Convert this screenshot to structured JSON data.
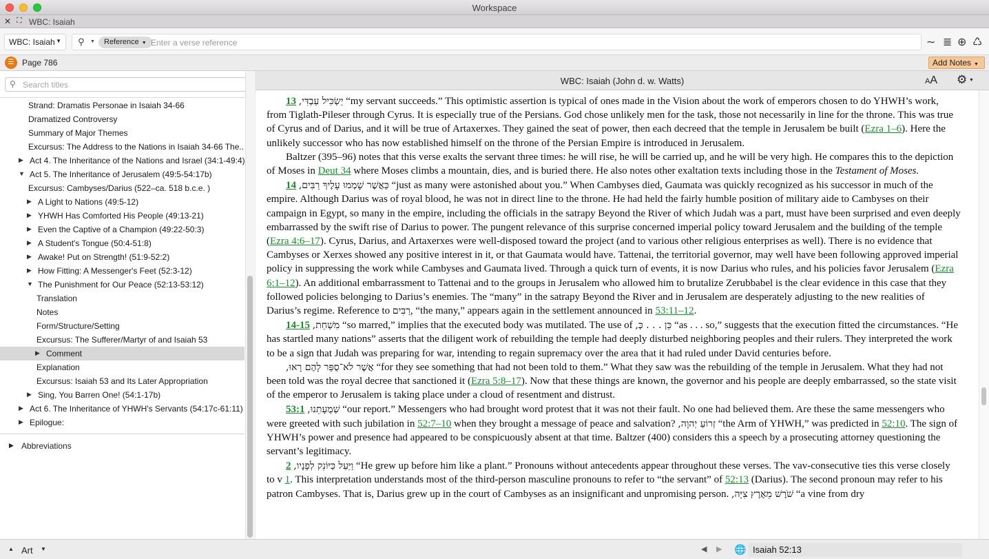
{
  "window": {
    "title": "Workspace"
  },
  "tab": {
    "label": "WBC: Isaiah",
    "close_glyph": "✕",
    "expand_glyph": "⛶"
  },
  "toolbar": {
    "resource": "WBC: Isaiah",
    "reference_pill": "Reference",
    "reference_placeholder": "Enter a verse reference",
    "icons": [
      "wave-icon",
      "list-icon",
      "add-circle-icon",
      "recycle-icon"
    ]
  },
  "subbar": {
    "page": "Page 786",
    "add_notes": "Add Notes"
  },
  "sidebar": {
    "search_placeholder": "Search titles",
    "toc": [
      {
        "label": "Strand: Dramatis Personae in Isaiah 34-66",
        "indent": 41,
        "arrow": ""
      },
      {
        "label": "Dramatized Controversy",
        "indent": 41,
        "arrow": ""
      },
      {
        "label": "Summary of Major Themes",
        "indent": 41,
        "arrow": ""
      },
      {
        "label": "Excursus: The Address to the Nations in Isaiah 34-66 The...",
        "indent": 41,
        "arrow": ""
      },
      {
        "label": "Act 4. The Inheritance of the Nations and Israel (34:1-49:4)",
        "indent": 43,
        "arrow": "right"
      },
      {
        "label": "Act 5. The Inheritance of Jerusalem (49:5-54:17b)",
        "indent": 43,
        "arrow": "down"
      },
      {
        "label": "Excursus: Cambyses/Darius (522–ca. 518 b.c.e. )",
        "indent": 41,
        "arrow": ""
      },
      {
        "label": "A Light to Nations (49:5-12)",
        "indent": 55,
        "arrow": "right"
      },
      {
        "label": "YHWH Has Comforted His People (49:13-21)",
        "indent": 55,
        "arrow": "right"
      },
      {
        "label": "Even the Captive of a Champion (49:22-50:3)",
        "indent": 55,
        "arrow": "right"
      },
      {
        "label": "A Student's Tongue (50:4-51:8)",
        "indent": 55,
        "arrow": "right"
      },
      {
        "label": "Awake! Put on Strength!  (51:9-52:2)",
        "indent": 55,
        "arrow": "right"
      },
      {
        "label": "How Fitting: A Messenger's Feet (52:3-12)",
        "indent": 55,
        "arrow": "right"
      },
      {
        "label": "The Punishment for Our Peace (52:13-53:12)",
        "indent": 55,
        "arrow": "down"
      },
      {
        "label": "Translation",
        "indent": 53,
        "arrow": ""
      },
      {
        "label": "Notes",
        "indent": 53,
        "arrow": ""
      },
      {
        "label": "Form/Structure/Setting",
        "indent": 53,
        "arrow": ""
      },
      {
        "label": "Excursus: The Sufferer/Martyr of and Isaiah 53",
        "indent": 53,
        "arrow": ""
      },
      {
        "label": "Comment",
        "indent": 67,
        "arrow": "right",
        "selected": true
      },
      {
        "label": "Explanation",
        "indent": 53,
        "arrow": ""
      },
      {
        "label": "Excursus: Isaiah 53 and Its Later Appropriation",
        "indent": 53,
        "arrow": ""
      },
      {
        "label": "Sing, You Barren One!  (54:1-17b)",
        "indent": 55,
        "arrow": "right"
      },
      {
        "label": "Act 6. The Inheritance of YHWH's Servants (54:17c-61:11)",
        "indent": 43,
        "arrow": "right"
      },
      {
        "label": "Epilogue:",
        "indent": 43,
        "arrow": "right"
      }
    ],
    "abbreviations": "Abbreviations"
  },
  "reader": {
    "title": "WBC: Isaiah (John d. w. Watts)",
    "font_icon_big": "A",
    "font_icon_small": "A"
  },
  "text": {
    "v13": "13",
    "v13_heb": "יַשְׂכִּיל עַבְדִּי,",
    "v13_a": " “my servant succeeds.” This optimistic assertion is typical of ones made in the Vision about the work of emperors chosen to do YHWH’s work, from Tiglath-Pileser through Cyrus. It is especially true of the Persians. God chose unlikely men for the task, those not necessarily in line for the throne. This was true of Cyrus and of Darius, and it will be true of Artaxerxes. They gained the seat of power, then each decreed that the temple in Jerusalem be built (",
    "v13_link": "Ezra 1–6",
    "v13_b": "). Here the unlikely successor who has now established himself on the throne of the Persian Empire is introduced in Jerusalem.",
    "p2_a": "Baltzer (395–96) notes that this verse exalts the servant three times: he will rise, he will be carried up, and he will be very high. He compares this to the depiction of Moses in ",
    "p2_link": "Deut 34",
    "p2_b": " where Moses climbs a mountain, dies, and is buried there. He also notes other exaltation texts including those in the ",
    "p2_ital": "Testament of Moses.",
    "v14": "14",
    "v14_heb": "כַּאֲשֶׁר שָׁמְמוּ עָלֶיךָ רַבִּים,",
    "v14_a": " “just as many were astonished about you.” When Cambyses died, Gaumata was quickly recognized as his successor in much of the empire. Although Darius was of royal blood, he was not in direct line to the throne. He had held the fairly humble position of military aide to Cambyses on their campaign in Egypt, so many in the empire, including the officials in the satrapy Beyond the River of which Judah was a part, must have been surprised and even deeply embarrassed by the swift rise of Darius to power. The pungent relevance of this surprise concerned imperial policy toward Jerusalem and the building of the temple (",
    "v14_link1": "Ezra 4:6–17",
    "v14_b": "). Cyrus, Darius, and Artaxerxes were well-disposed toward the project (and to various other religious enterprises as well). There is no evidence that Cambyses or Xerxes showed any positive interest in it, or that Gaumata would have. Tattenai, the territorial governor, may well have been following approved imperial policy in suppressing the work while Cambyses and Gaumata lived. Through a quick turn of events, it is now Darius who rules, and his policies favor Jerusalem (",
    "v14_link2": "Ezra 6:1–12",
    "v14_c": "). An additional embarrassment to Tattenai and to the groups in Jerusalem who allowed him to brutalize Zerubbabel is the clear evidence in this case that they followed policies belonging to Darius’s enemies. The “many” in the satrapy Beyond the River and in Jerusalem are desperately adjusting to the new realities of Darius’s regime. Reference to ",
    "v14_heb2": "רַבִּים",
    "v14_d": ", “the many,” appears again in the settlement announced in ",
    "v14_link3": "53:11–12",
    "v14_e": ".",
    "v1415": "14-15",
    "v1415_heb": "מִשְׁחַת,",
    "v1415_a": " “so marred,” implies that the executed body was mutilated. The use of ",
    "v1415_heb2": "כֵּן . . . כְּ,",
    "v1415_b": " “as . . . so,” suggests that the execution fitted the circumstances. “He has startled many nations” asserts that the diligent work of rebuilding the temple had deeply disturbed neighboring peoples and their rulers. They interpreted the work to be a sign that Judah was preparing for war, intending to regain supremacy over the area that it had ruled under David centuries before.",
    "p5_heb": "אֲשֶׁר לֹא־סֻפַּר לָהֶם רָאוּ,",
    "p5_a": " “for they see something that had not been told to them.” What they saw was the rebuilding of the temple in Jerusalem. What they had not been told was the royal decree that sanctioned it (",
    "p5_link": "Ezra 5:8–17",
    "p5_b": "). Now that these things are known, the governor and his people are deeply embarrassed, so the state visit of the emperor to Jerusalem is taking place under a cloud of resentment and distrust.",
    "v531": "53:1",
    "v531_heb": "שְׁמֻעָתֵנוּ,",
    "v531_a": " “our report.” Messengers who had brought word protest that it was not their fault. No one had believed them. Are these the same messengers who were greeted with such jubilation in ",
    "v531_link1": "52:7–10",
    "v531_b": " when they brought a message of peace and salvation? ",
    "v531_heb2": "זְרוֹעַ יְהוָה,",
    "v531_c": " “the Arm of YHWH,” was predicted in ",
    "v531_link2": "52:10",
    "v531_d": ". The sign of YHWH’s power and presence had appeared to be conspicuously absent at that time. Baltzer (400) considers this a speech by a prosecuting attorney questioning the servant’s legitimacy.",
    "v2": "2",
    "v2_heb": "וַיַּעַל כַּיּוֹנֵק לְפָנָיו,",
    "v2_a": " “He grew up before him like a plant.” Pronouns without antecedents appear throughout these verses. The vav-consecutive ties this verse closely to v ",
    "v2_link1": "1",
    "v2_b": ". This interpretation understands most of the third-person masculine pronouns to refer to “the servant” of ",
    "v2_link2": "52:13",
    "v2_c": " (Darius). The second pronoun may refer to his patron Cambyses. That is, Darius grew up in the court of Cambyses as an insignificant and unpromising person. ",
    "v2_heb2": "שֹׁרֶשׁ מֵאֶרֶץ צִיָּה,",
    "v2_d": " “a vine from dry"
  },
  "bottom": {
    "art_label": "Art",
    "location": "Isaiah  52:13"
  }
}
